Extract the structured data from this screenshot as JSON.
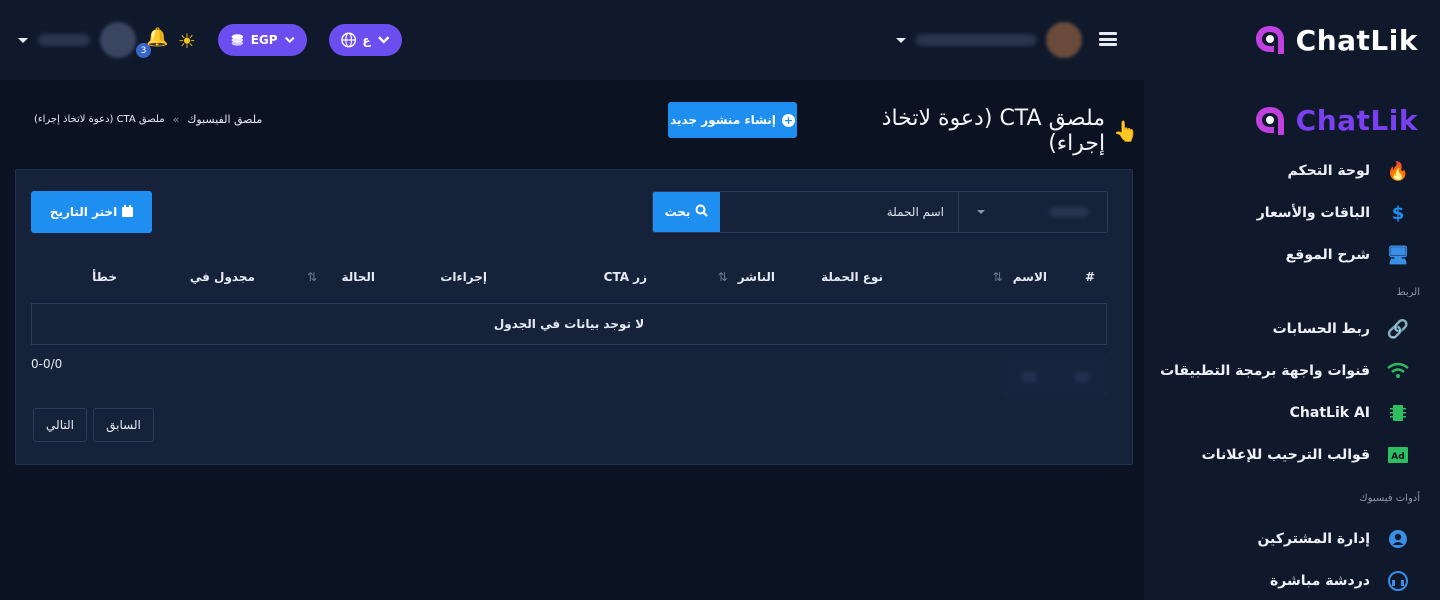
{
  "brand": {
    "name": "ChatLik"
  },
  "topbar": {
    "language_pill": "ع",
    "currency_pill": "EGP",
    "notification_count": "3"
  },
  "sidebar": {
    "items": [
      {
        "label": "لوحة التحكم",
        "icon": "fire-icon"
      },
      {
        "label": "الباقات والأسعار",
        "icon": "dollar-icon"
      },
      {
        "label": "شرح الموقع",
        "icon": "screen-icon"
      }
    ],
    "section_link": "الربط",
    "link_items": [
      {
        "label": "ربط الحسابات",
        "icon": "link-icon"
      },
      {
        "label": "قنوات واجهة برمجة التطبيقات",
        "icon": "wifi-icon"
      },
      {
        "label": "ChatLik AI",
        "icon": "chip-icon"
      },
      {
        "label": "قوالب الترحيب للإعلانات",
        "icon": "ad-icon"
      }
    ],
    "section_facebook": "أدوات فيسبوك",
    "fb_items": [
      {
        "label": "إدارة المشتركين",
        "icon": "user-circle-icon"
      },
      {
        "label": "دردشة مباشرة",
        "icon": "headset-icon"
      }
    ]
  },
  "page": {
    "title": "ملصق CTA (دعوة لاتخاذ إجراء)",
    "create_button": "إنشاء منشور جديد",
    "breadcrumb": {
      "parent": "ملصق الفيسبوك",
      "separator": "»",
      "current": "ملصق CTA (دعوة لاتخاذ إجراء)"
    }
  },
  "filters": {
    "search_placeholder": "اسم الحملة",
    "search_button": "بحث",
    "date_button": "اختر التاريخ"
  },
  "table": {
    "columns": [
      "#",
      "الاسم",
      "نوع الحملة",
      "الناشر",
      "زر CTA",
      "إجراءات",
      "الحالة",
      "مجدول في",
      "خطأ"
    ],
    "empty_message": "لا توجد بيانات في الجدول",
    "range": "0-0/0"
  },
  "pagination": {
    "prev": "السابق",
    "next": "التالي"
  },
  "colors": {
    "primary": "#1f8ef1",
    "accent": "#6b4ef0",
    "bg": "#0b1222",
    "sidebar": "#10192c"
  }
}
